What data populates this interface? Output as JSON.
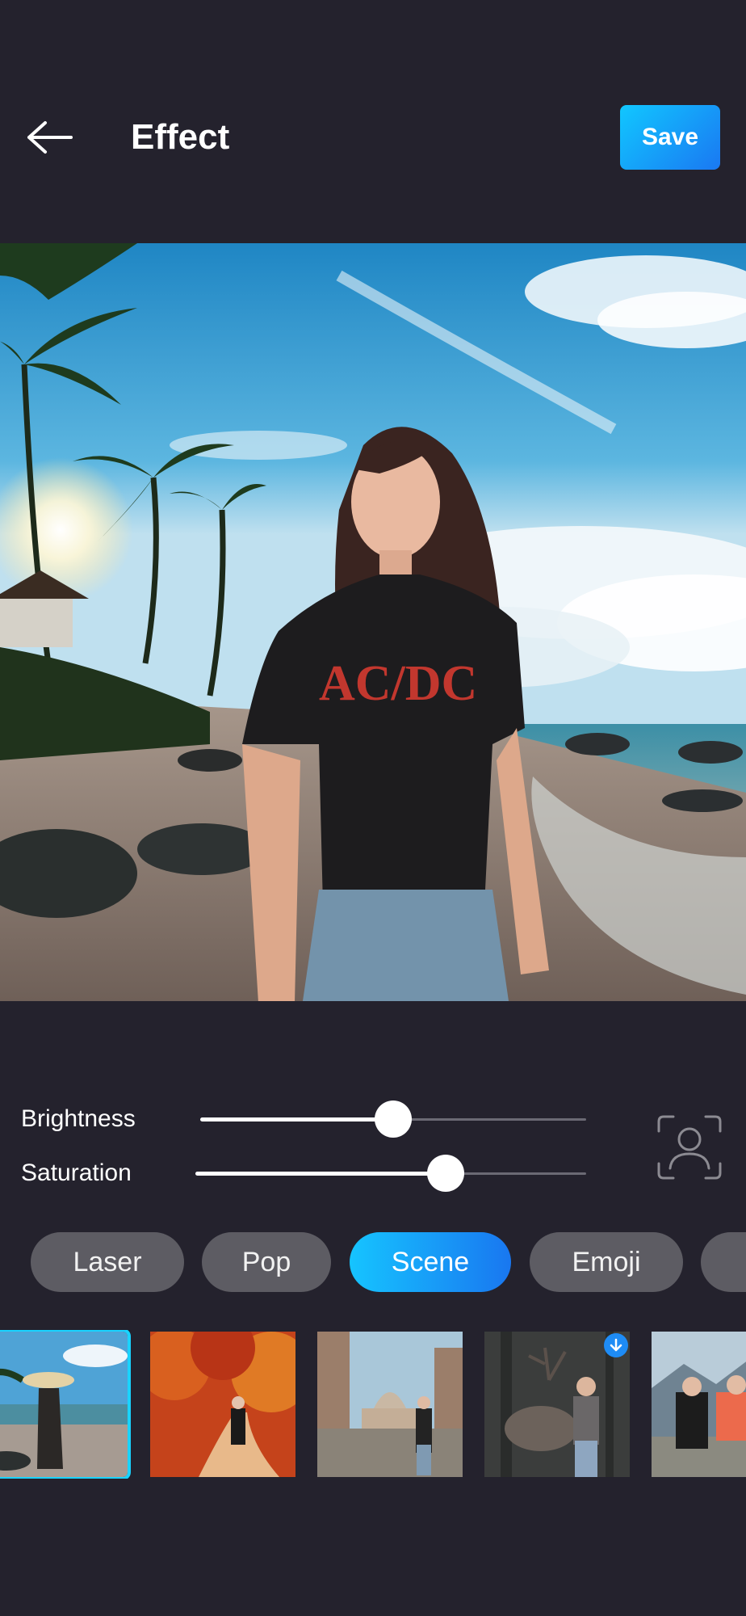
{
  "header": {
    "title": "Effect",
    "save_label": "Save"
  },
  "sliders": {
    "brightness": {
      "label": "Brightness",
      "value": 0.5
    },
    "saturation": {
      "label": "Saturation",
      "value": 0.64
    }
  },
  "tabs": [
    {
      "label": "Laser",
      "active": false
    },
    {
      "label": "Pop",
      "active": false
    },
    {
      "label": "Scene",
      "active": true
    },
    {
      "label": "Emoji",
      "active": false
    }
  ],
  "thumbnails": [
    {
      "scene": "beach",
      "selected": true,
      "downloadable": false
    },
    {
      "scene": "autumn-park",
      "selected": false,
      "downloadable": false
    },
    {
      "scene": "vatican-plaza",
      "selected": false,
      "downloadable": false
    },
    {
      "scene": "deer-forest",
      "selected": false,
      "downloadable": true
    },
    {
      "scene": "mountain-couple",
      "selected": false,
      "downloadable": false
    }
  ],
  "colors": {
    "background": "#24222d",
    "accent": "#16c4ff",
    "accent_end": "#1977f0",
    "tab_inactive": "#5d5c63"
  },
  "icons": {
    "back": "back-arrow-icon",
    "person": "person-select-icon",
    "download": "download-icon"
  }
}
